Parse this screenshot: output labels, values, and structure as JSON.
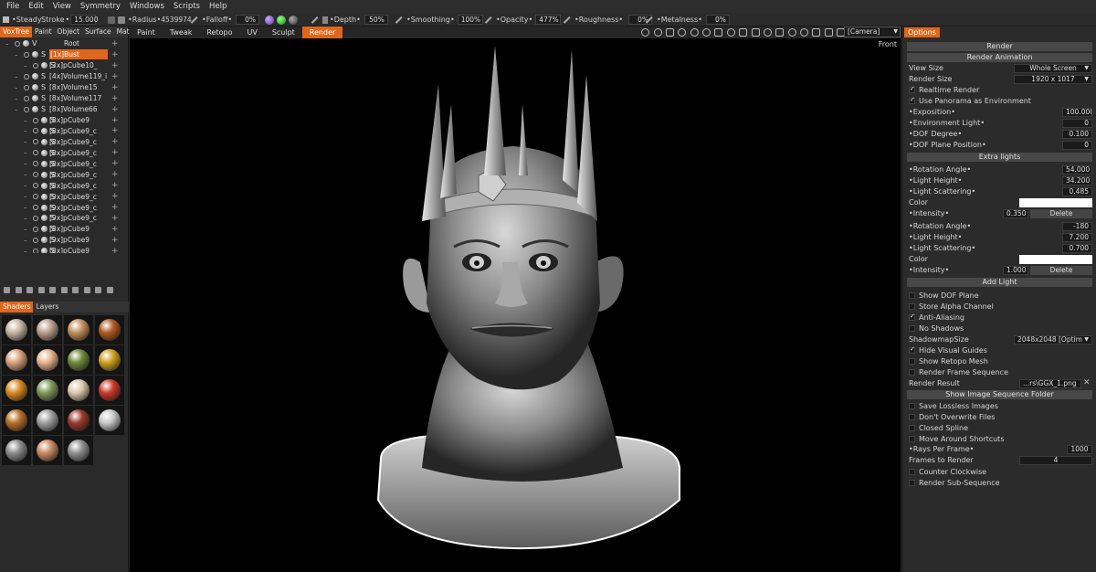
{
  "menu": [
    "File",
    "Edit",
    "View",
    "Symmetry",
    "Windows",
    "Scripts",
    "Help"
  ],
  "toolbar": {
    "steady": "Steady",
    "stroke_label": "Stroke",
    "stroke_value": "15.000",
    "radius_label": "Radius",
    "radius_value": "4539974",
    "falloff_label": "Falloff",
    "falloff_value": "0%",
    "depth_label": "Depth",
    "depth_value": "50%",
    "smoothing_label": "Smoothing",
    "smoothing_value": "100%",
    "opacity_label": "Opacity",
    "opacity_value": "477%",
    "roughness_label": "Roughness",
    "roughness_value": "0%",
    "metalness_label": "Metalness",
    "metalness_value": "0%"
  },
  "left_tabs": [
    "VoxTree",
    "Paint",
    "Object",
    "Surface",
    "Mat"
  ],
  "mode_tabs": [
    "Paint",
    "Tweak",
    "Retopo",
    "UV",
    "Sculpt",
    "Render"
  ],
  "active_mode": "Render",
  "camera": "[Camera]",
  "view_label": "Front",
  "voxtree": [
    {
      "tag": "V",
      "name": "Root",
      "indent": 0
    },
    {
      "tag": "S",
      "name": "[1x]Bust",
      "indent": 1,
      "selected": true
    },
    {
      "tag": "S",
      "name": "[3x]pCube10_",
      "indent": 2
    },
    {
      "tag": "S",
      "name": "[4x]Volume119_i",
      "indent": 1
    },
    {
      "tag": "S",
      "name": "[8x]Volume15",
      "indent": 1
    },
    {
      "tag": "S",
      "name": "[8x]Volume117",
      "indent": 1
    },
    {
      "tag": "S",
      "name": "[8x]Volume66",
      "indent": 1
    },
    {
      "tag": "S",
      "name": "[8x]pCube9",
      "indent": 2
    },
    {
      "tag": "S",
      "name": "[8x]pCube9_c",
      "indent": 2
    },
    {
      "tag": "S",
      "name": "[8x]pCube9_c",
      "indent": 2
    },
    {
      "tag": "S",
      "name": "[8x]pCube9_c",
      "indent": 2
    },
    {
      "tag": "S",
      "name": "[8x]pCube9_c",
      "indent": 2
    },
    {
      "tag": "S",
      "name": "[8x]pCube9_c",
      "indent": 2
    },
    {
      "tag": "S",
      "name": "[8x]pCube9_c",
      "indent": 2
    },
    {
      "tag": "S",
      "name": "[9x]pCube9_c",
      "indent": 2
    },
    {
      "tag": "S",
      "name": "[9x]pCube9_c",
      "indent": 2
    },
    {
      "tag": "S",
      "name": "[9x]pCube9_c",
      "indent": 2
    },
    {
      "tag": "S",
      "name": "[8x]pCube9",
      "indent": 2
    },
    {
      "tag": "S",
      "name": "[9x]pCube9",
      "indent": 2
    },
    {
      "tag": "S",
      "name": "[8x]pCube9",
      "indent": 2
    }
  ],
  "shader_tabs": [
    "Shaders",
    "Layers"
  ],
  "shaders": [
    {
      "color": "#c8b6a4",
      "kind": "sss-skin"
    },
    {
      "color": "#bda08c",
      "kind": "skin"
    },
    {
      "color": "#c4905e",
      "kind": "clay"
    },
    {
      "color": "#b35a24",
      "kind": "rust"
    },
    {
      "color": "#d9a27c",
      "kind": "skin-light"
    },
    {
      "color": "#e8b48e",
      "kind": "peach"
    },
    {
      "color": "#6f8a3a",
      "kind": "moss"
    },
    {
      "color": "#d1a020",
      "kind": "gold"
    },
    {
      "color": "#d88a20",
      "kind": "amber"
    },
    {
      "color": "#7f9a5a",
      "kind": "jade"
    },
    {
      "color": "#dcc8b0",
      "kind": "ivory"
    },
    {
      "color": "#cc3a28",
      "kind": "red"
    },
    {
      "color": "#b87028",
      "kind": "copper"
    },
    {
      "color": "#a0a0a0",
      "kind": "chrome"
    },
    {
      "color": "#9a3a2e",
      "kind": "terracotta"
    },
    {
      "color": "#c8c8c8",
      "kind": "silver"
    },
    {
      "color": "#8c8c8c",
      "kind": "steel"
    },
    {
      "color": "#c98a62",
      "kind": "bronze-skin"
    },
    {
      "color": "#909090",
      "kind": "metal"
    }
  ],
  "options_tab": "Options",
  "render": {
    "render_btn": "Render",
    "render_anim_btn": "Render Animation",
    "view_size_label": "View Size",
    "view_size": "Whole Screen",
    "render_size_label": "Render Size",
    "render_size": "1920  x 1017",
    "realtime": "Realtime Render",
    "panorama": "Use Panorama as Environment",
    "exposition_label": "Exposition",
    "exposition": "100.000",
    "env_light_label": "Environment Light",
    "env_light": "0",
    "dof_label": "DOF Degree",
    "dof": "0.100",
    "dof_plane_label": "DOF Plane Position",
    "dof_plane": "0",
    "extra_lights": "Extra lights",
    "light1": {
      "rot_label": "Rotation Angle",
      "rot": "54.000",
      "height_label": "Light Height",
      "height": "34.200",
      "scat_label": "Light Scattering",
      "scat": "0.485",
      "color_label": "Color",
      "int_label": "Intensity",
      "int": "0.350",
      "delete": "Delete"
    },
    "light2": {
      "rot_label": "Rotation Angle",
      "rot": "-180",
      "height_label": "Light Height",
      "height": "7.200",
      "scat_label": "Light Scattering",
      "scat": "0.700",
      "color_label": "Color",
      "int_label": "Intensity",
      "int": "1.000",
      "delete": "Delete"
    },
    "add_light": "Add Light",
    "show_dof": "Show DOF Plane",
    "store_alpha": "Store Alpha Channel",
    "anti_alias": "Anti-Aliasing",
    "no_shadows": "No Shadows",
    "shadow_label": "ShadowmapSize",
    "shadow": "2048x2048 [Optim",
    "hide_guides": "Hide Visual Guides",
    "show_retopo": "Show Retopo Mesh",
    "render_seq": "Render Frame Sequence",
    "result_label": "Render Result",
    "result": "...rs\\GGX_1.png",
    "show_folder": "Show Image Sequence Folder",
    "save_lossless": "Save Lossless Images",
    "dont_overwrite": "Don't Overwrite Files",
    "closed_spline": "Closed Spline",
    "move_around": "Move Around Shortcuts",
    "rays_label": "Rays Per Frame",
    "rays": "1000",
    "frames_label": "Frames to Render",
    "frames": "4",
    "counter_cw": "Counter Clockwise",
    "render_sub": "Render Sub-Sequence"
  }
}
